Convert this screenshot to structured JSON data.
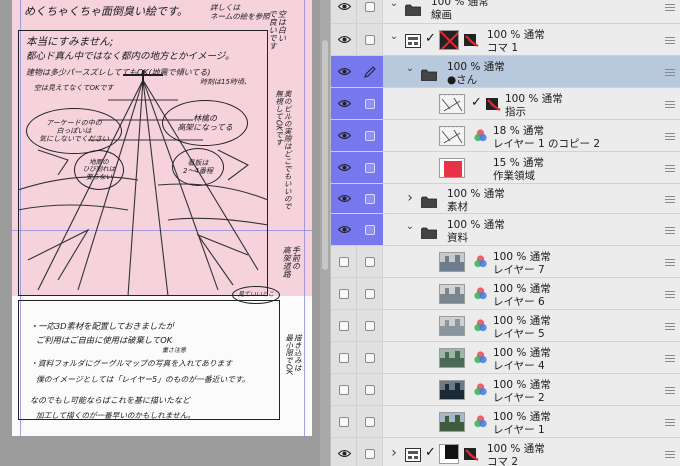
{
  "canvas": {
    "page_texts": {
      "top_left": "めくちゃくちゃ面倒臭い絵です。",
      "top_note": "詳しくは\nネームの絵を参照",
      "apology": "本当にすみません;",
      "line2": "都心ド真ん中ではなく都内の地方とかイメージ。",
      "line3": "建物は多少パースズレしててもOK(地震で傾いてる)",
      "line3b": "時刻は15時頃、",
      "line4": "空は見えてなくてOKです",
      "bubble_left": "アーケードの中の\n白っぽいは\n気にしないでください",
      "bubble_mid": "林檎の\n高架になってる",
      "bubble_small": "地面の\nひび割れは\n要らない",
      "bubble_right_small": "看板は\n2〜4番程",
      "vertical_right_top": "空は白い\nで良いです",
      "vertical_right_mid": "奥のビルの実際はどこでもいいので\n無視してOKです",
      "vertical_right_low": "手前の\n高架道路",
      "small_oval": "見ていいとこ",
      "bottom_line1": "・一応3D素材を配置しておきましたが",
      "bottom_line2": "ご利用はご自由に使用は破棄してOK",
      "bottom_line3": "・資料フォルダにグーグルマップの写真を入れてあります",
      "bottom_line4": "僕のイメージとしては「レイヤー5」のものが一番近いです。",
      "bottom_line5": "なのでもし可能ならばこれを基に描いたなど",
      "bottom_line6": "加工して描くのが一番早いのかもしれません。",
      "bottom_small": "重さ注意",
      "bottom_right_v": "描き込みは\n最小限でOK"
    }
  },
  "layers": [
    {
      "id": "senga-folder",
      "type": "folder",
      "opacity_blend": "100 %  通常",
      "name": "線画",
      "visible": true,
      "expanded": true
    },
    {
      "id": "koma1",
      "type": "frame",
      "opacity_blend": "100 %  通常",
      "name": "コマ 1",
      "visible": true,
      "expanded": true
    },
    {
      "id": "san-folder",
      "type": "folder",
      "opacity_blend": "100 %  通常",
      "name": "●さん",
      "visible": true,
      "expanded": true,
      "selected": true
    },
    {
      "id": "shiji",
      "type": "raster",
      "opacity_blend": "100 %  通常",
      "name": "指示",
      "visible": true
    },
    {
      "id": "layer1copy2",
      "type": "raster",
      "opacity_blend": "18 %  通常",
      "name": "レイヤー 1 のコピー 2",
      "visible": true
    },
    {
      "id": "sagyou",
      "type": "raster",
      "opacity_blend": "15 %  通常",
      "name": "作業領域",
      "visible": true
    },
    {
      "id": "sozai",
      "type": "folder",
      "opacity_blend": "100 %  通常",
      "name": "素材",
      "visible": true,
      "expanded": false
    },
    {
      "id": "shiryou",
      "type": "folder",
      "opacity_blend": "100 %  通常",
      "name": "資料",
      "visible": true,
      "expanded": true
    },
    {
      "id": "layer7",
      "type": "raster",
      "opacity_blend": "100 %  通常",
      "name": "レイヤー 7",
      "visible": false
    },
    {
      "id": "layer6",
      "type": "raster",
      "opacity_blend": "100 %  通常",
      "name": "レイヤー 6",
      "visible": false
    },
    {
      "id": "layer5",
      "type": "raster",
      "opacity_blend": "100 %  通常",
      "name": "レイヤー 5",
      "visible": false
    },
    {
      "id": "layer4",
      "type": "raster",
      "opacity_blend": "100 %  通常",
      "name": "レイヤー 4",
      "visible": false
    },
    {
      "id": "layer2",
      "type": "raster",
      "opacity_blend": "100 %  通常",
      "name": "レイヤー 2",
      "visible": false
    },
    {
      "id": "layer1",
      "type": "raster",
      "opacity_blend": "100 %  通常",
      "name": "レイヤー 1",
      "visible": false
    },
    {
      "id": "koma2",
      "type": "frame",
      "opacity_blend": "100 %  通常",
      "name": "コマ 2",
      "visible": true,
      "expanded": false
    }
  ],
  "colors": {
    "selected_row": "#b8c8dd",
    "palette_highlight": "#7777ee",
    "work_area": "#e83346",
    "pink_overlay": "#f5d2dc"
  },
  "icons": {
    "eye": "eye-icon",
    "pen": "pen-icon",
    "folder": "folder-icon",
    "chevron_down": "chevron-down-icon",
    "chevron_right": "chevron-right-icon",
    "color_circles": "color-layer-icon",
    "mask": "mask-icon",
    "check": "check-icon",
    "drag": "drag-handle-icon"
  }
}
